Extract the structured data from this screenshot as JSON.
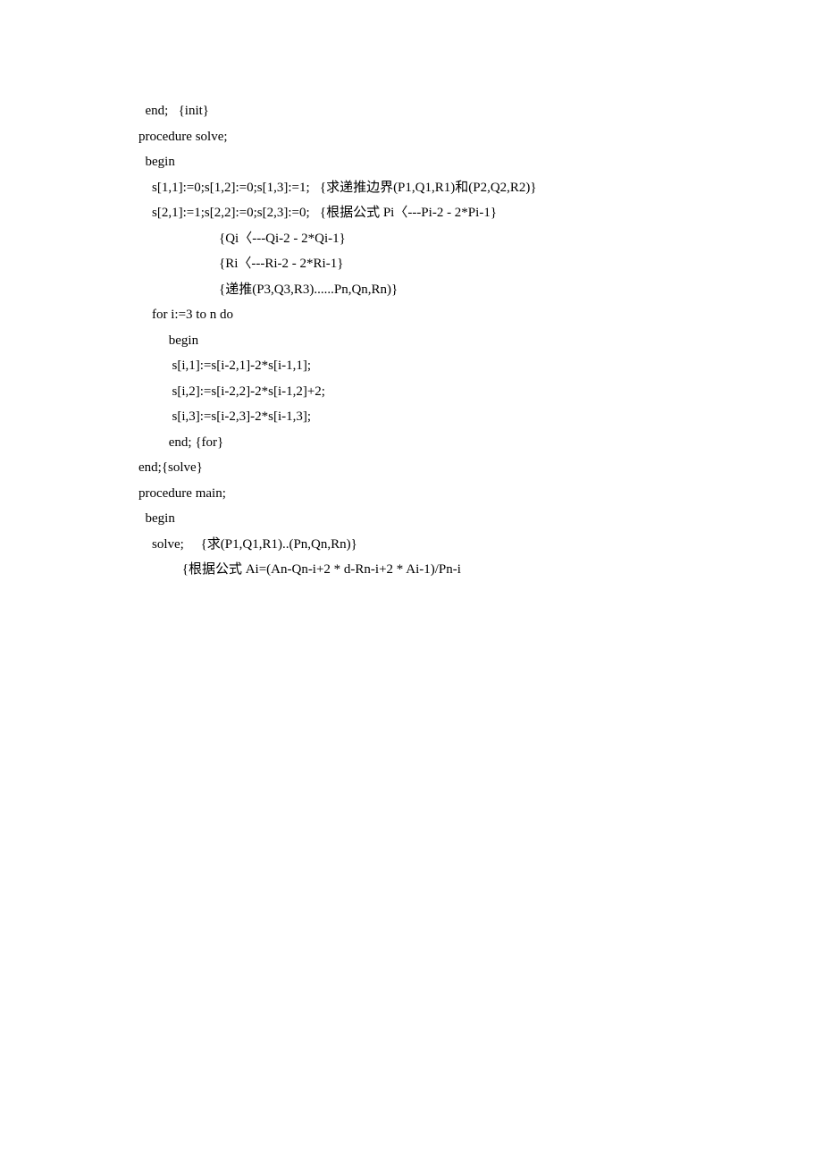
{
  "lines": [
    "  end;   {init}",
    "procedure solve;",
    "  begin",
    "    s[1,1]:=0;s[1,2]:=0;s[1,3]:=1;   {求递推边界(P1,Q1,R1)和(P2,Q2,R2)}",
    "    s[2,1]:=1;s[2,2]:=0;s[2,3]:=0;   {根据公式 Pi〈---Pi-2 - 2*Pi-1}",
    "                        {Qi〈---Qi-2 - 2*Qi-1}",
    "                        {Ri〈---Ri-2 - 2*Ri-1}",
    "                        {递推(P3,Q3,R3)......Pn,Qn,Rn)}",
    "    for i:=3 to n do",
    "         begin",
    "          s[i,1]:=s[i-2,1]-2*s[i-1,1];",
    "          s[i,2]:=s[i-2,2]-2*s[i-1,2]+2;",
    "          s[i,3]:=s[i-2,3]-2*s[i-1,3];",
    "         end; {for}",
    "",
    "",
    "end;{solve}",
    "procedure main;",
    "  begin",
    "    solve;     {求(P1,Q1,R1)..(Pn,Qn,Rn)}",
    "             {根据公式 Ai=(An-Qn-i+2 * d-Rn-i+2 * Ai-1)/Pn-i"
  ]
}
